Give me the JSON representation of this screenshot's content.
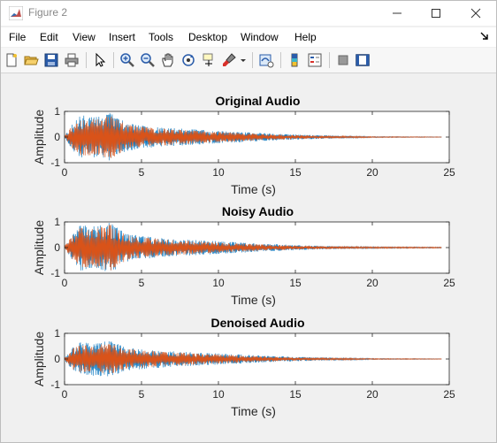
{
  "window": {
    "title": "Figure 2",
    "controls": {
      "minimize": "minimize",
      "maximize": "maximize",
      "close": "close"
    }
  },
  "menu": {
    "items": [
      "File",
      "Edit",
      "View",
      "Insert",
      "Tools",
      "Desktop",
      "Window",
      "Help"
    ]
  },
  "toolbar": {
    "icons": [
      "new-figure-icon",
      "open-icon",
      "save-icon",
      "print-icon",
      "pointer-icon",
      "zoom-in-icon",
      "zoom-out-icon",
      "pan-icon",
      "rotate-3d-icon",
      "data-cursor-icon",
      "brush-icon",
      "link-plot-icon",
      "colorbar-icon",
      "legend-icon",
      "hide-plot-tools-icon",
      "show-plot-tools-icon"
    ]
  },
  "colors": {
    "series1": "#0072BD",
    "series2": "#D95319",
    "axes": "#262626",
    "background": "#f0f0f0"
  },
  "chart_data": [
    {
      "type": "line",
      "title": "Original Audio",
      "xlabel": "Time (s)",
      "ylabel": "Amplitude",
      "xlim": [
        0,
        25
      ],
      "ylim": [
        -1,
        1
      ],
      "xticks": [
        "0",
        "5",
        "10",
        "15",
        "20",
        "25"
      ],
      "yticks": [
        "-1",
        "0",
        "1"
      ],
      "series": [
        {
          "envelope_time": [
            0,
            0.5,
            1,
            2,
            3,
            4,
            5,
            7,
            10,
            13,
            16,
            20,
            24.5
          ],
          "envelope_amplitude": [
            0.05,
            0.5,
            0.85,
            0.8,
            0.95,
            0.55,
            0.45,
            0.35,
            0.25,
            0.15,
            0.08,
            0.02,
            0.01
          ]
        },
        {
          "envelope_time": [
            0,
            0.5,
            1,
            2,
            3,
            4,
            5,
            7,
            10,
            13,
            16,
            20,
            24.5
          ],
          "envelope_amplitude": [
            0.05,
            0.45,
            0.75,
            0.7,
            0.85,
            0.5,
            0.4,
            0.3,
            0.2,
            0.12,
            0.06,
            0.02,
            0.01
          ]
        }
      ]
    },
    {
      "type": "line",
      "title": "Noisy Audio",
      "xlabel": "Time (s)",
      "ylabel": "Amplitude",
      "xlim": [
        0,
        25
      ],
      "ylim": [
        -1,
        1
      ],
      "xticks": [
        "0",
        "5",
        "10",
        "15",
        "20",
        "25"
      ],
      "yticks": [
        "-1",
        "0",
        "1"
      ],
      "series": [
        {
          "envelope_time": [
            0,
            0.5,
            1,
            2,
            3,
            4,
            5,
            7,
            10,
            13,
            16,
            20,
            24.5
          ],
          "envelope_amplitude": [
            0.06,
            0.5,
            0.9,
            0.85,
            0.98,
            0.55,
            0.45,
            0.35,
            0.25,
            0.15,
            0.08,
            0.03,
            0.02
          ]
        },
        {
          "envelope_time": [
            0,
            0.5,
            1,
            2,
            3,
            4,
            5,
            7,
            10,
            13,
            16,
            20,
            24.5
          ],
          "envelope_amplitude": [
            0.06,
            0.45,
            0.8,
            0.75,
            0.9,
            0.5,
            0.4,
            0.3,
            0.2,
            0.12,
            0.06,
            0.03,
            0.02
          ]
        }
      ]
    },
    {
      "type": "line",
      "title": "Denoised Audio",
      "xlabel": "Time (s)",
      "ylabel": "Amplitude",
      "xlim": [
        0,
        25
      ],
      "ylim": [
        -1,
        1
      ],
      "xticks": [
        "0",
        "5",
        "10",
        "15",
        "20",
        "25"
      ],
      "yticks": [
        "-1",
        "0",
        "1"
      ],
      "series": [
        {
          "envelope_time": [
            0,
            0.5,
            1,
            2,
            3,
            4,
            5,
            7,
            10,
            13,
            16,
            20,
            24.5
          ],
          "envelope_amplitude": [
            0.05,
            0.45,
            0.65,
            0.65,
            0.7,
            0.45,
            0.4,
            0.3,
            0.22,
            0.13,
            0.07,
            0.02,
            0.01
          ]
        },
        {
          "envelope_time": [
            0,
            0.5,
            1,
            2,
            3,
            4,
            5,
            7,
            10,
            13,
            16,
            20,
            24.5
          ],
          "envelope_amplitude": [
            0.05,
            0.4,
            0.55,
            0.55,
            0.6,
            0.4,
            0.35,
            0.27,
            0.18,
            0.1,
            0.05,
            0.02,
            0.01
          ]
        }
      ]
    }
  ]
}
